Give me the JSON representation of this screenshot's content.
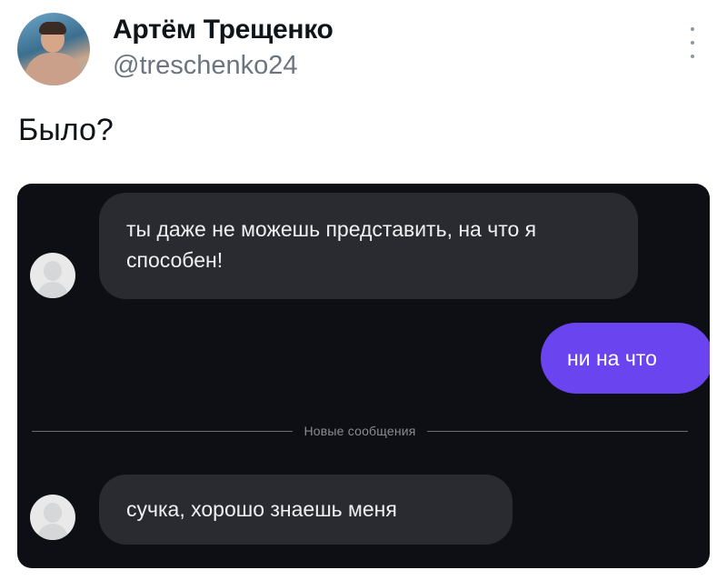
{
  "tweet": {
    "author_name": "Артём Трещенко",
    "author_handle": "@treschenko24",
    "text": "Было?"
  },
  "chat": {
    "messages": [
      {
        "from": "other",
        "text": "ты даже не можешь представить, на что я способен!"
      },
      {
        "from": "me",
        "text": "ни на что"
      },
      {
        "from": "other",
        "text": "сучка, хорошо знаешь меня"
      }
    ],
    "divider_label": "Новые сообщения",
    "colors": {
      "background": "#0e0f14",
      "incoming_bubble": "#2a2b30",
      "outgoing_bubble": "#6a44ef"
    }
  }
}
